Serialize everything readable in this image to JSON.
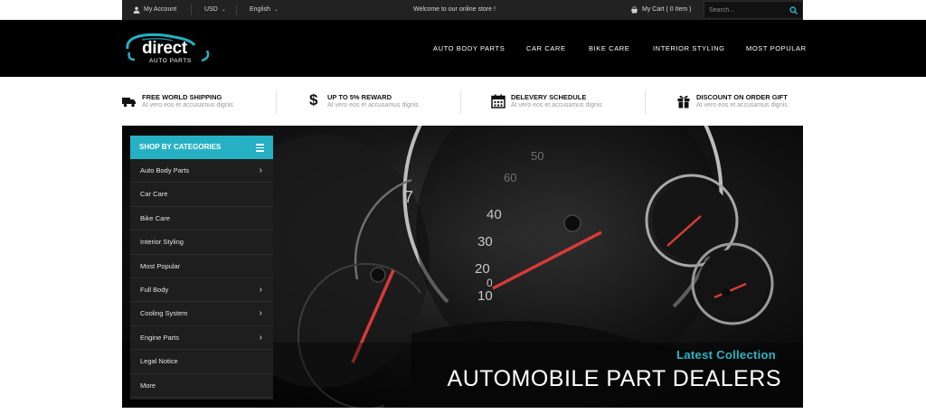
{
  "topbar": {
    "account": "My Account",
    "currency": "USD",
    "language": "English",
    "welcome": "Welcome to our online store !",
    "cart": "My Cart ( 0 Item )",
    "search_placeholder": "Search..."
  },
  "logo": {
    "main": "direct",
    "sub": "AUTO PARTS"
  },
  "nav": [
    "AUTO BODY PARTS",
    "CAR CARE",
    "BIKE CARE",
    "INTERIOR STYLING",
    "MOST POPULAR"
  ],
  "features": [
    {
      "title": "FREE WORLD SHIPPING",
      "subtitle": "At vero eos et accusamus dignis",
      "icon": "truck-icon"
    },
    {
      "title": "UP TO 5% REWARD",
      "subtitle": "At vero eos et accusamus dignis",
      "icon": "dollar-icon"
    },
    {
      "title": "DELEVERY SCHEDULE",
      "subtitle": "At vero eos et accusamus dignis",
      "icon": "calendar-icon"
    },
    {
      "title": "DISCOUNT ON ORDER GIFT",
      "subtitle": "At vero eos et accusamus dignis",
      "icon": "gift-icon"
    }
  ],
  "categories": {
    "header": "SHOP BY CATEGORIES",
    "items": [
      {
        "label": "Auto Body Parts",
        "has_submenu": true
      },
      {
        "label": "Car Care",
        "has_submenu": false
      },
      {
        "label": "Bike Care",
        "has_submenu": false
      },
      {
        "label": "Interior Styling",
        "has_submenu": false
      },
      {
        "label": "Most Popular",
        "has_submenu": false
      },
      {
        "label": "Full Body",
        "has_submenu": true
      },
      {
        "label": "Cooling System",
        "has_submenu": true
      },
      {
        "label": "Engine Parts",
        "has_submenu": true
      },
      {
        "label": "Legal Notice",
        "has_submenu": false
      },
      {
        "label": "More",
        "has_submenu": false
      }
    ]
  },
  "hero": {
    "subtitle": "Latest Collection",
    "title": "AUTOMOBILE PART DEALERS",
    "gauge_numbers": [
      "60",
      "50",
      "40",
      "30",
      "20",
      "10",
      "0",
      "7"
    ]
  },
  "colors": {
    "accent": "#25b1c3",
    "dark": "#000000",
    "topbar": "#222222",
    "needle": "#d63a3a"
  }
}
